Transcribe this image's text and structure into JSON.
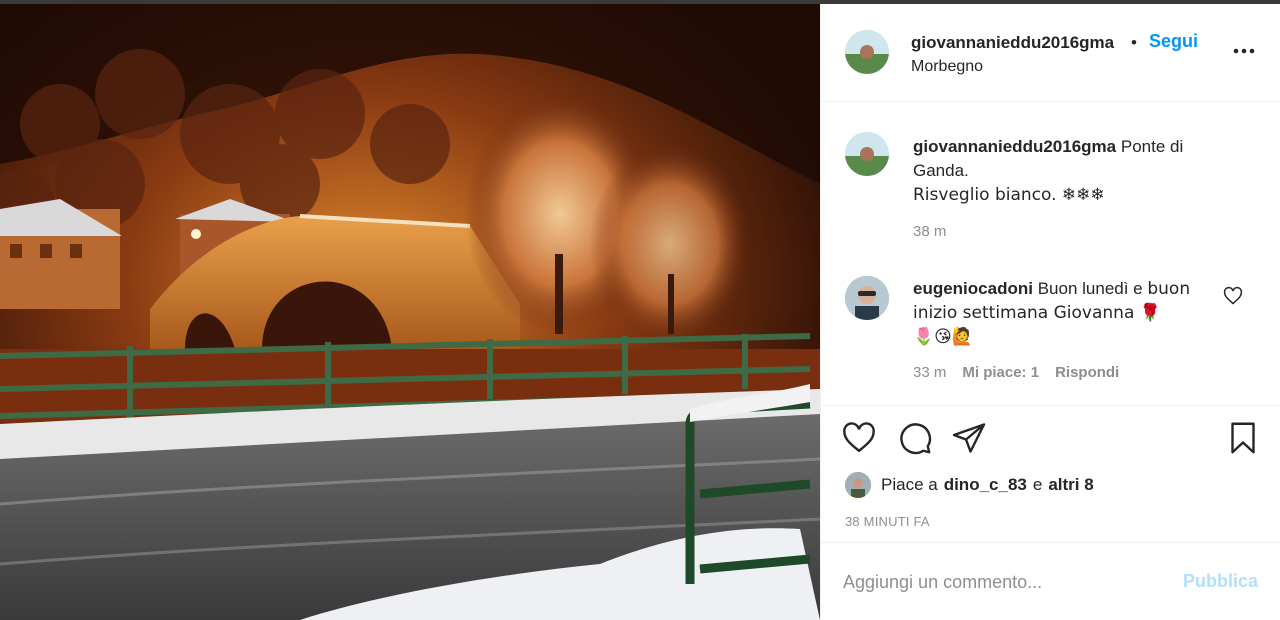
{
  "post": {
    "username": "giovannanieddu2016gma",
    "separator": "•",
    "follow_label": "Segui",
    "location": "Morbegno",
    "more_icon": "more-horizontal-icon"
  },
  "caption": {
    "username": "giovannanieddu2016gma",
    "text_line1": "Ponte di",
    "text_line2": "Ganda.",
    "text_line3": "Risveglio bianco. ❄❄❄",
    "time": "38 m"
  },
  "comment": {
    "username": "eugeniocadoni",
    "text_part1": "Buon lunedì e",
    "text_part2": "buon inizio settimana Giovanna 🌹",
    "text_part3": "🌷😘🙋",
    "time": "33 m",
    "likes_label": "Mi piace: 1",
    "reply_label": "Rispondi",
    "heart_icon": "heart-outline-icon"
  },
  "actions": {
    "like_icon": "heart-icon",
    "comment_icon": "comment-bubble-icon",
    "share_icon": "send-icon",
    "save_icon": "bookmark-icon"
  },
  "likes": {
    "prefix": "Piace a",
    "user": "dino_c_83",
    "conj": "e",
    "others": "altri 8"
  },
  "timestamp": "38 MINUTI FA",
  "add_comment": {
    "placeholder": "Aggiungi un commento...",
    "publish_label": "Pubblica"
  },
  "colors": {
    "link_blue": "#0095f6",
    "publish_disabled": "#b2dffc",
    "muted": "#8e8e8e",
    "text": "#262626"
  }
}
